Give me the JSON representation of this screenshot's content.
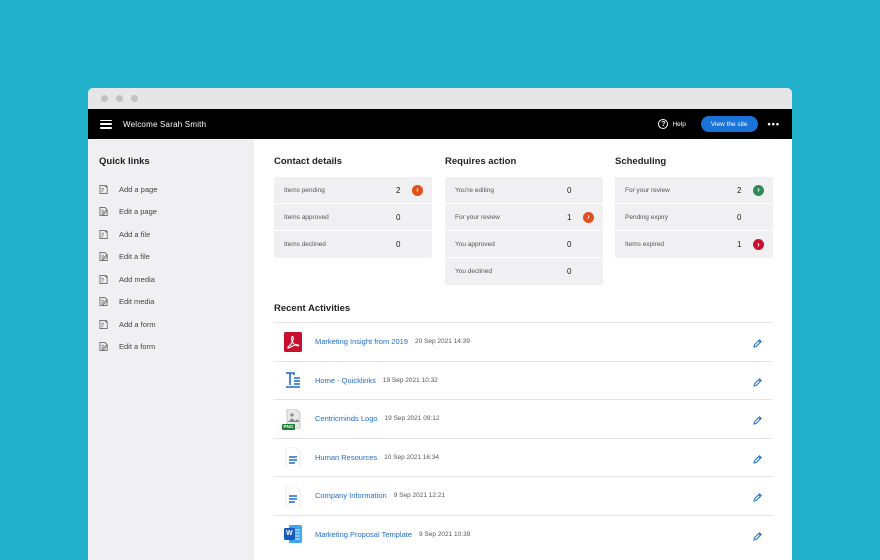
{
  "topbar": {
    "welcome": "Welcome Sarah Smith",
    "help_label": "Help",
    "help_glyph": "?",
    "view_site_label": "View the site",
    "more_glyph": "•••",
    "icons": [
      "hamburger-icon",
      "help-icon",
      "more-icon"
    ]
  },
  "sidebar": {
    "title": "Quick links",
    "items": [
      {
        "label": "Add a page",
        "icon": "add-page-icon"
      },
      {
        "label": "Edit a page",
        "icon": "edit-page-icon"
      },
      {
        "label": "Add a file",
        "icon": "add-file-icon"
      },
      {
        "label": "Edit a file",
        "icon": "edit-file-icon"
      },
      {
        "label": "Add media",
        "icon": "add-media-icon"
      },
      {
        "label": "Edit media",
        "icon": "edit-media-icon"
      },
      {
        "label": "Add a form",
        "icon": "add-form-icon"
      },
      {
        "label": "Edit a form",
        "icon": "edit-form-icon"
      }
    ]
  },
  "contact": {
    "title": "Contact details",
    "rows": [
      {
        "label": "Items pending",
        "count": "2",
        "badge": "›",
        "badge_color": "#e0501f"
      },
      {
        "label": "Items approved",
        "count": "0"
      },
      {
        "label": "Items declined",
        "count": "0"
      }
    ]
  },
  "action": {
    "title": "Requires action",
    "rows": [
      {
        "label": "You're editing",
        "count": "0"
      },
      {
        "label": "For your review",
        "count": "1",
        "badge": "›",
        "badge_color": "#e0501f"
      },
      {
        "label": "You approved",
        "count": "0"
      },
      {
        "label": "You declined",
        "count": "0"
      }
    ]
  },
  "scheduling": {
    "title": "Scheduling",
    "rows": [
      {
        "label": "For your review",
        "count": "2",
        "badge": "›",
        "badge_color": "#2e8b57"
      },
      {
        "label": "Pending expiry",
        "count": "0"
      },
      {
        "label": "Items expired",
        "count": "1",
        "badge": "›",
        "badge_color": "#c8102e"
      }
    ]
  },
  "recent": {
    "title": "Recent Activities",
    "items": [
      {
        "name": "Marketing Insight from 2019",
        "date": "20 Sep 2021 14:39",
        "icon": "pdf-icon"
      },
      {
        "name": "Home - Quicklinks",
        "date": "19 Sep 2021 10:32",
        "icon": "text-page-icon"
      },
      {
        "name": "Centricminds Logo",
        "date": "19 Sep 2021 09:12",
        "icon": "png-image-icon",
        "icon_tag": "PNG"
      },
      {
        "name": "Human Resources",
        "date": "10 Sep 2021 16:34",
        "icon": "document-icon"
      },
      {
        "name": "Company Information",
        "date": "9 Sep 2021 12:21",
        "icon": "document-icon"
      },
      {
        "name": "Marketing Proposal Template",
        "date": "9 Sep 2021 10:39",
        "icon": "word-icon",
        "icon_tag": "W"
      }
    ]
  },
  "colors": {
    "background": "#22b2cb",
    "topbar": "#000000",
    "accent": "#1a73d9",
    "link": "#1f6cc9"
  }
}
